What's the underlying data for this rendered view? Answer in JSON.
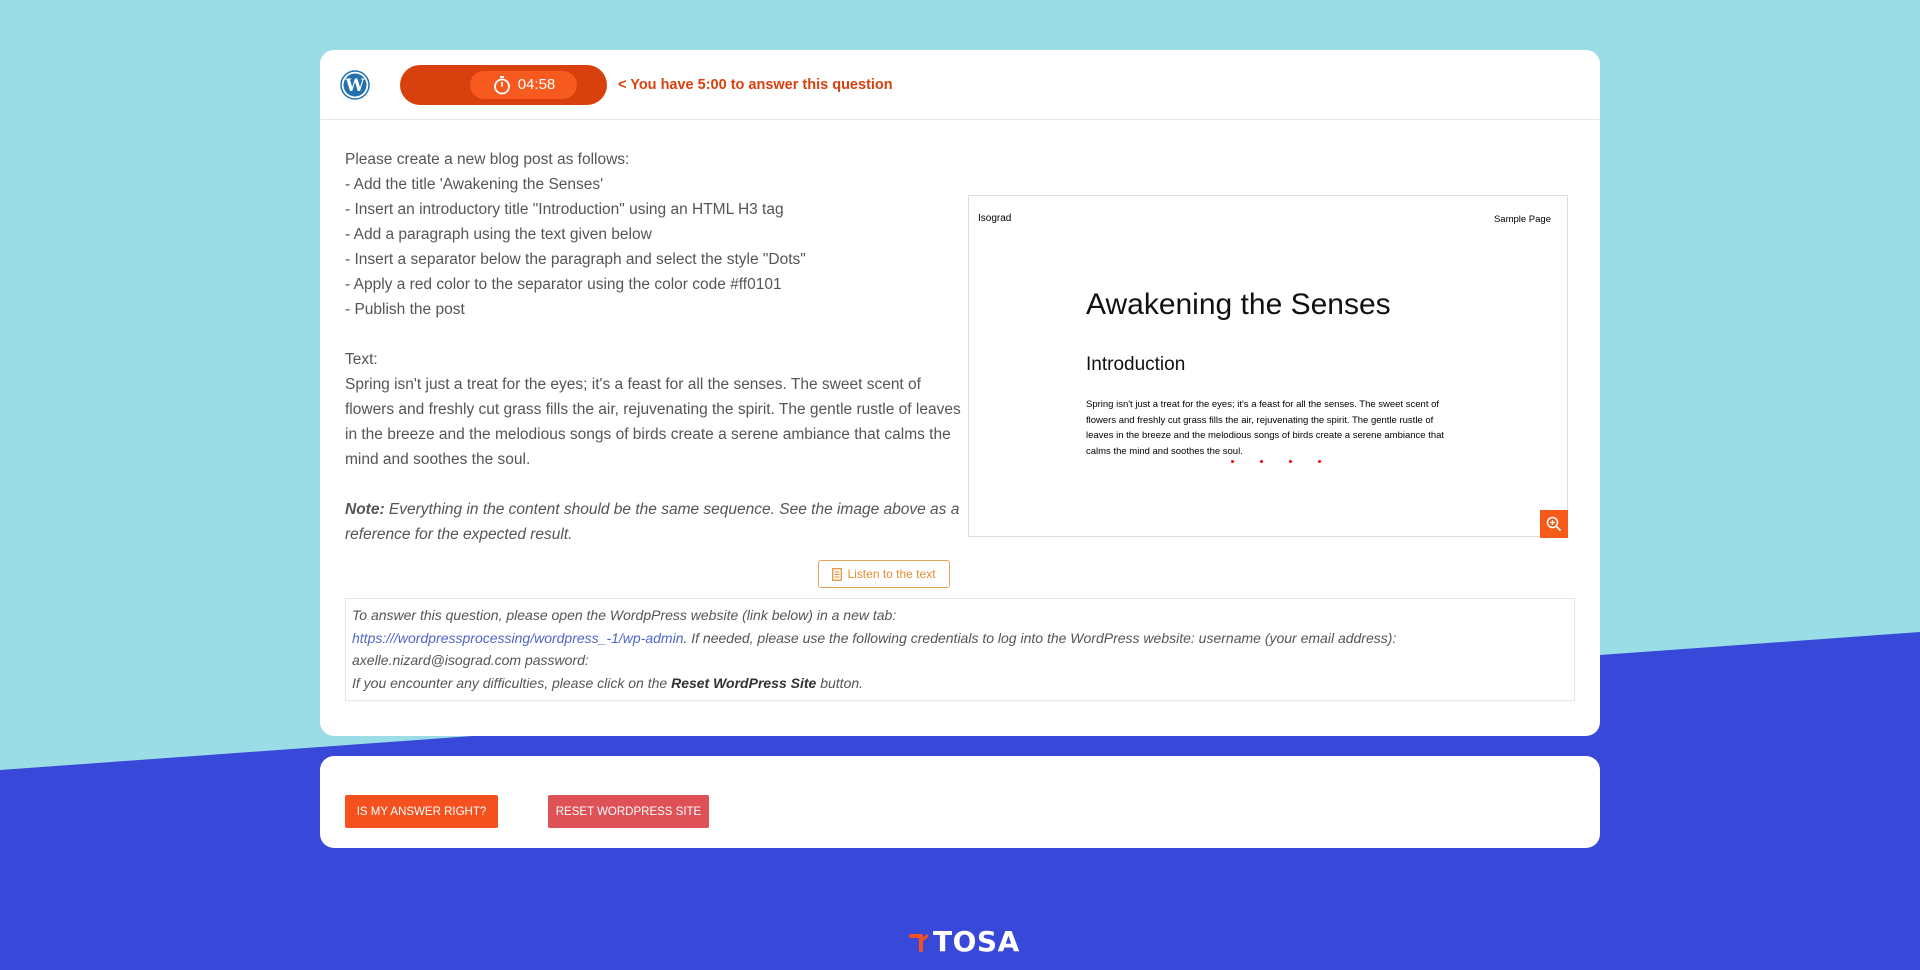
{
  "header": {
    "timer": "04:58",
    "time_note": "< You have 5:00 to answer this question"
  },
  "instructions": {
    "lines": [
      "Please create a new blog post as follows:",
      "- Add the title 'Awakening the Senses'",
      "- Insert an introductory title \"Introduction\" using an HTML H3 tag",
      "- Add a paragraph using the text given below",
      "- Insert a separator below the paragraph and select the style \"Dots\"",
      "- Apply a red color to the separator using the color code #ff0101",
      "- Publish the post"
    ],
    "text_label": "Text:",
    "text_body": "Spring isn't just a treat for the eyes; it's a feast for all the senses. The sweet scent of flowers and freshly cut grass fills the air, rejuvenating the spirit. The gentle rustle of leaves in the breeze and the melodious songs of birds create a serene ambiance that calms the mind and soothes the soul.",
    "note_label": "Note:",
    "note_text": " Everything in the content should be the same sequence. See the image above as a reference for the expected result."
  },
  "preview": {
    "site_name": "Isograd",
    "nav_link": "Sample Page",
    "post_title": "Awakening the Senses",
    "h3": "Introduction",
    "paragraph": "Spring isn't just a treat for the eyes; it's a feast for all the senses. The sweet scent of flowers and freshly cut grass fills the air, rejuvenating the spirit. The gentle rustle of leaves in the breeze and the melodious songs of birds create a serene ambiance that calms the mind and soothes the soul.",
    "separator_color": "#ff0101"
  },
  "listen_label": "Listen to the text",
  "info": {
    "line1": "To answer this question, please open the WordpPress website (link below) in a new tab:",
    "link": "https:///wordpressprocessing/wordpress_-1/wp-admin",
    "line2_rest": ". If needed, please use the following credentials to log into the WordPress website: username (your email address):",
    "line3": "axelle.nizard@isograd.com password:",
    "line4_pre": "If you encounter any difficulties, please click on the ",
    "line4_bold": "Reset WordPress Site",
    "line4_post": " button."
  },
  "actions": {
    "answer_label": "IS MY ANSWER RIGHT?",
    "reset_label": "RESET WORDPRESS SITE"
  },
  "footer": {
    "brand": "TOSA"
  },
  "colors": {
    "accent": "#f4511e",
    "timer_dark": "#d8410e",
    "reset_red": "#dd5157",
    "bg_cyan": "#9adde6",
    "bg_blue": "#3848d8"
  }
}
